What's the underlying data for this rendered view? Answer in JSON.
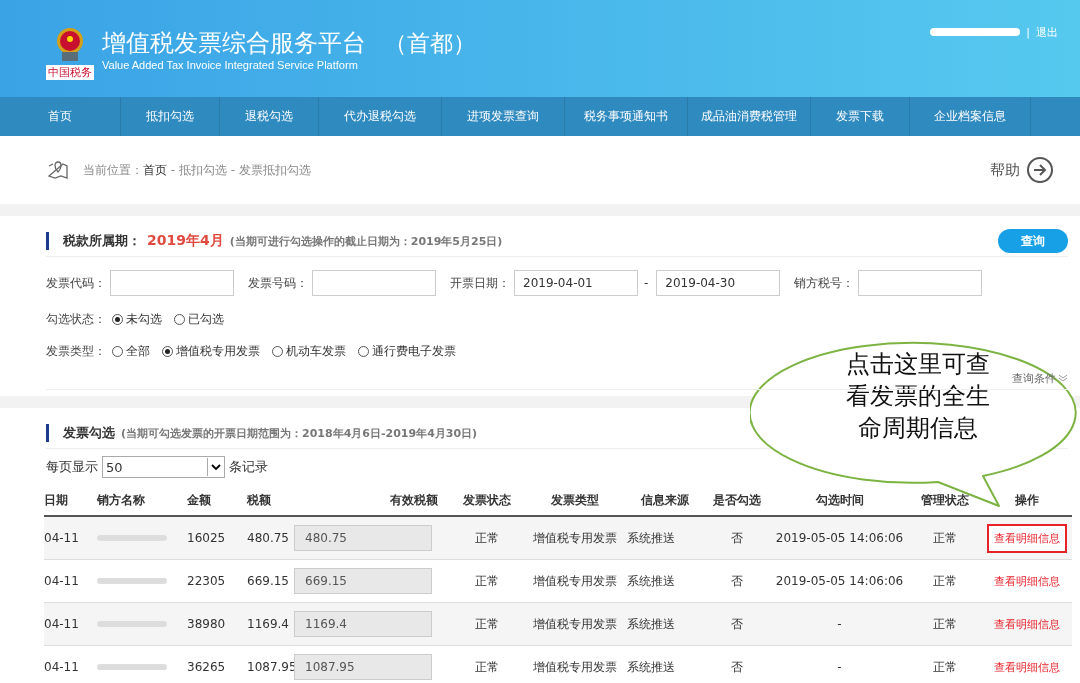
{
  "header": {
    "title": "增值税发票综合服务平台",
    "region": "（首都）",
    "subtitle": "Value Added Tax Invoice Integrated Service Platform",
    "logo_caption": "中国税务",
    "separator": "|",
    "logout": "退出"
  },
  "nav": [
    {
      "label": "首页",
      "selected": false
    },
    {
      "label": "抵扣勾选",
      "selected": false
    },
    {
      "label": "退税勾选",
      "selected": false
    },
    {
      "label": "代办退税勾选",
      "selected": false
    },
    {
      "label": "进项发票查询",
      "selected": false
    },
    {
      "label": "税务事项通知书",
      "selected": false
    },
    {
      "label": "成品油消费税管理",
      "selected": false
    },
    {
      "label": "发票下载",
      "selected": false
    },
    {
      "label": "企业档案信息",
      "selected": false
    }
  ],
  "breadcrumb": {
    "prefix": "当前位置：",
    "items": [
      "首页",
      "抵扣勾选",
      "发票抵扣勾选"
    ],
    "separator": " - ",
    "help": "帮助"
  },
  "period": {
    "label": "税款所属期：",
    "value": "2019年4月",
    "note": "(当期可进行勾选操作的截止日期为：2019年5月25日)",
    "search_button": "查询"
  },
  "filters": [
    {
      "label": "发票代码："
    },
    {
      "label": "发票号码："
    },
    {
      "label": "开票日期：",
      "value": "2019-04-01",
      "kind": "range",
      "value_to": "2019-04-30",
      "dash": "-"
    },
    {
      "label": "销方税号："
    }
  ],
  "radio_groups": [
    {
      "label": "勾选状态：",
      "options": [
        {
          "label": "未勾选",
          "selected": true
        },
        {
          "label": "已勾选",
          "selected": false
        }
      ]
    },
    {
      "label": "发票类型：",
      "options": [
        {
          "label": "全部",
          "selected": false
        },
        {
          "label": "增值税专用发票",
          "selected": true
        },
        {
          "label": "机动车发票",
          "selected": false
        },
        {
          "label": "通行费电子发票",
          "selected": false
        }
      ]
    }
  ],
  "toggle_conditions": "查询条件",
  "invoices": {
    "title": "发票勾选",
    "note": "(当期可勾选发票的开票日期范围为：2018年4月6日-2019年4月30日)",
    "page_size_label": "每页显示",
    "page_size": "50",
    "page_size_suffix": "条记录",
    "columns": [
      "日期",
      "销方名称",
      "金额",
      "税额",
      "有效税额",
      "发票状态",
      "发票类型",
      "信息来源",
      "是否勾选",
      "勾选时间",
      "管理状态",
      "操作"
    ],
    "rows": [
      {
        "date": "04-11",
        "amount": "16025",
        "tax": "480.75",
        "effective_tax": "480.75",
        "status": "正常",
        "type": "增值税专用发票",
        "source": "系统推送",
        "checked": "否",
        "time": "2019-05-05 14:06:06",
        "manage": "正常",
        "action": "查看明细信息",
        "highlighted": true
      },
      {
        "date": "04-11",
        "amount": "22305",
        "tax": "669.15",
        "effective_tax": "669.15",
        "status": "正常",
        "type": "增值税专用发票",
        "source": "系统推送",
        "checked": "否",
        "time": "2019-05-05 14:06:06",
        "manage": "正常",
        "action": "查看明细信息",
        "highlighted": false
      },
      {
        "date": "04-11",
        "amount": "38980",
        "tax": "1169.4",
        "effective_tax": "1169.4",
        "status": "正常",
        "type": "增值税专用发票",
        "source": "系统推送",
        "checked": "否",
        "time": "-",
        "manage": "正常",
        "action": "查看明细信息",
        "highlighted": false
      },
      {
        "date": "04-11",
        "amount": "36265",
        "tax": "1087.95",
        "effective_tax": "1087.95",
        "status": "正常",
        "type": "增值税专用发票",
        "source": "系统推送",
        "checked": "否",
        "time": "-",
        "manage": "正常",
        "action": "查看明细信息",
        "highlighted": false
      }
    ]
  },
  "callout": {
    "lines": [
      "点击这里可查",
      "看发票的全生",
      "命周期信息"
    ]
  }
}
